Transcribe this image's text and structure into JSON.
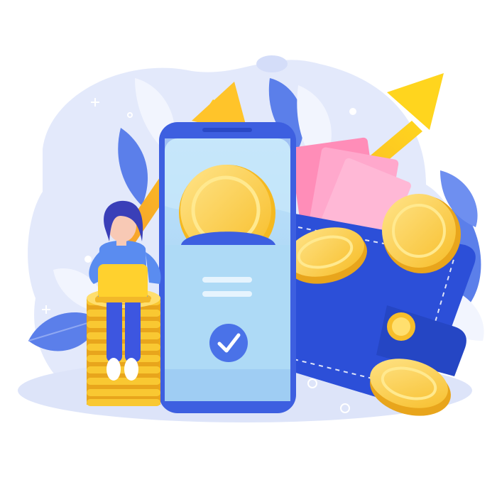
{
  "illustration": {
    "subject": "mobile-payment-savings",
    "colors": {
      "background_blob": "#E3E9FB",
      "ground_shadow": "#DCE3F9",
      "leaf_blue": "#5B7FEA",
      "leaf_light": "#F2F5FE",
      "phone_body": "#3D5FE0",
      "phone_screen": "#A9D6F5",
      "coin_gold": "#F9C832",
      "coin_light": "#FFE07A",
      "coin_shadow": "#E8A51C",
      "arrow_orange": "#F7A52A",
      "arrow_yellow": "#FFD21F",
      "banknote_pink": "#FFA1C6",
      "wallet_blue": "#2C4FD8",
      "wallet_dark": "#2546C4",
      "check_circle": "#4A72E8",
      "person_hair": "#3A3FB8",
      "person_shirt": "#5A8CF0",
      "person_pants": "#3D56E0",
      "person_skin": "#F8C9B5",
      "laptop": "#FFD12E"
    },
    "icons": [
      "check-icon",
      "sparkle-icon",
      "coin-icon",
      "wallet-icon",
      "growth-arrow-icon"
    ]
  }
}
